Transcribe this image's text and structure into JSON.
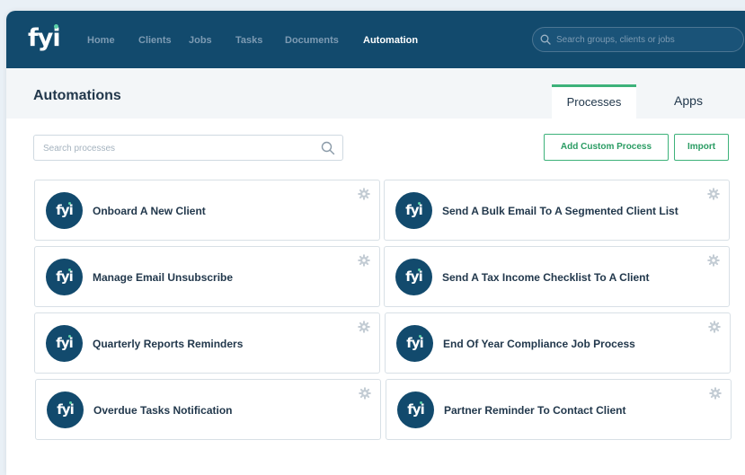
{
  "brand": {
    "logo_text": "fyi"
  },
  "nav": {
    "items": [
      {
        "label": "Home",
        "active": false
      },
      {
        "label": "Clients",
        "active": false
      },
      {
        "label": "Jobs",
        "active": false
      },
      {
        "label": "Tasks",
        "active": false
      },
      {
        "label": "Documents",
        "active": false
      },
      {
        "label": "Automation",
        "active": true
      }
    ]
  },
  "global_search": {
    "placeholder": "Search groups, clients or jobs",
    "icon": "search-icon"
  },
  "page": {
    "title": "Automations"
  },
  "tabs": [
    {
      "label": "Processes",
      "active": true
    },
    {
      "label": "Apps",
      "active": false
    }
  ],
  "process_search": {
    "placeholder": "Search processes",
    "icon": "search-icon"
  },
  "actions": {
    "add_custom": "Add Custom Process",
    "import": "Import"
  },
  "processes": [
    {
      "avatar": "fyi",
      "label": "Onboard A New Client",
      "icon": "gear-icon"
    },
    {
      "avatar": "fyi",
      "label": "Send A Bulk Email To A Segmented Client List",
      "icon": "gear-icon"
    },
    {
      "avatar": "fyi",
      "label": "Manage Email Unsubscribe",
      "icon": "gear-icon"
    },
    {
      "avatar": "fyi",
      "label": "Send A Tax Income Checklist To A Client",
      "icon": "gear-icon"
    },
    {
      "avatar": "fyi",
      "label": "Quarterly Reports Reminders",
      "icon": "gear-icon"
    },
    {
      "avatar": "fyi",
      "label": "End Of Year Compliance Job Process",
      "icon": "gear-icon"
    },
    {
      "avatar": "fyi",
      "label": "Overdue Tasks Notification",
      "icon": "gear-icon"
    },
    {
      "avatar": "fyi",
      "label": "Partner Reminder To Contact Client",
      "icon": "gear-icon"
    }
  ],
  "colors": {
    "header_bg": "#124a6d",
    "accent_green": "#3db27a",
    "text_dark": "#22384c",
    "nav_inactive": "#7d9bb3"
  }
}
